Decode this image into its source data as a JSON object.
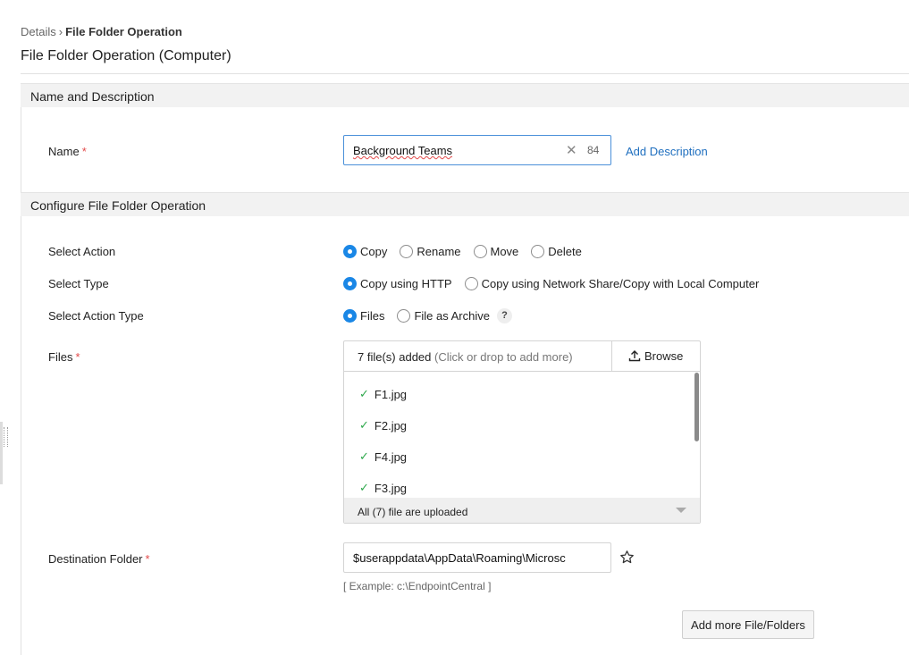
{
  "breadcrumb": {
    "parent": "Details",
    "current": "File Folder Operation"
  },
  "page": {
    "title": "File Folder Operation (Computer)"
  },
  "sections": {
    "name_desc": "Name and Description",
    "configure": "Configure File Folder Operation"
  },
  "name_field": {
    "label": "Name",
    "required_mark": "*",
    "value": "Background Teams",
    "char_count": "84",
    "add_description": "Add Description"
  },
  "select_action": {
    "label": "Select Action",
    "options": [
      "Copy",
      "Rename",
      "Move",
      "Delete"
    ],
    "selected": "Copy"
  },
  "select_type": {
    "label": "Select Type",
    "options": [
      "Copy using HTTP",
      "Copy using Network Share/Copy with Local Computer"
    ],
    "selected": "Copy using HTTP"
  },
  "select_action_type": {
    "label": "Select Action Type",
    "options": [
      "Files",
      "File as Archive"
    ],
    "selected": "Files",
    "help": "?"
  },
  "files": {
    "label": "Files",
    "required_mark": "*",
    "count_text": "7 file(s) added",
    "hint": "(Click or drop to add more)",
    "browse": "Browse",
    "items": [
      "F1.jpg",
      "F2.jpg",
      "F4.jpg",
      "F3.jpg"
    ],
    "status": "All (7) file are uploaded"
  },
  "destination": {
    "label": "Destination Folder",
    "required_mark": "*",
    "value": "$userappdata\\AppData\\Roaming\\Microsc",
    "example": "[ Example: c:\\EndpointCentral ]"
  },
  "add_more_button": "Add more File/Folders",
  "colors": {
    "accent": "#1a87e6",
    "link": "#1f6fbf",
    "required": "#e24a4a",
    "success": "#2ea84c"
  },
  "icons": {
    "clear": "close-icon",
    "upload": "upload-icon",
    "check": "check-icon",
    "favorite": "star-icon",
    "dropdown": "caret-down-icon"
  }
}
